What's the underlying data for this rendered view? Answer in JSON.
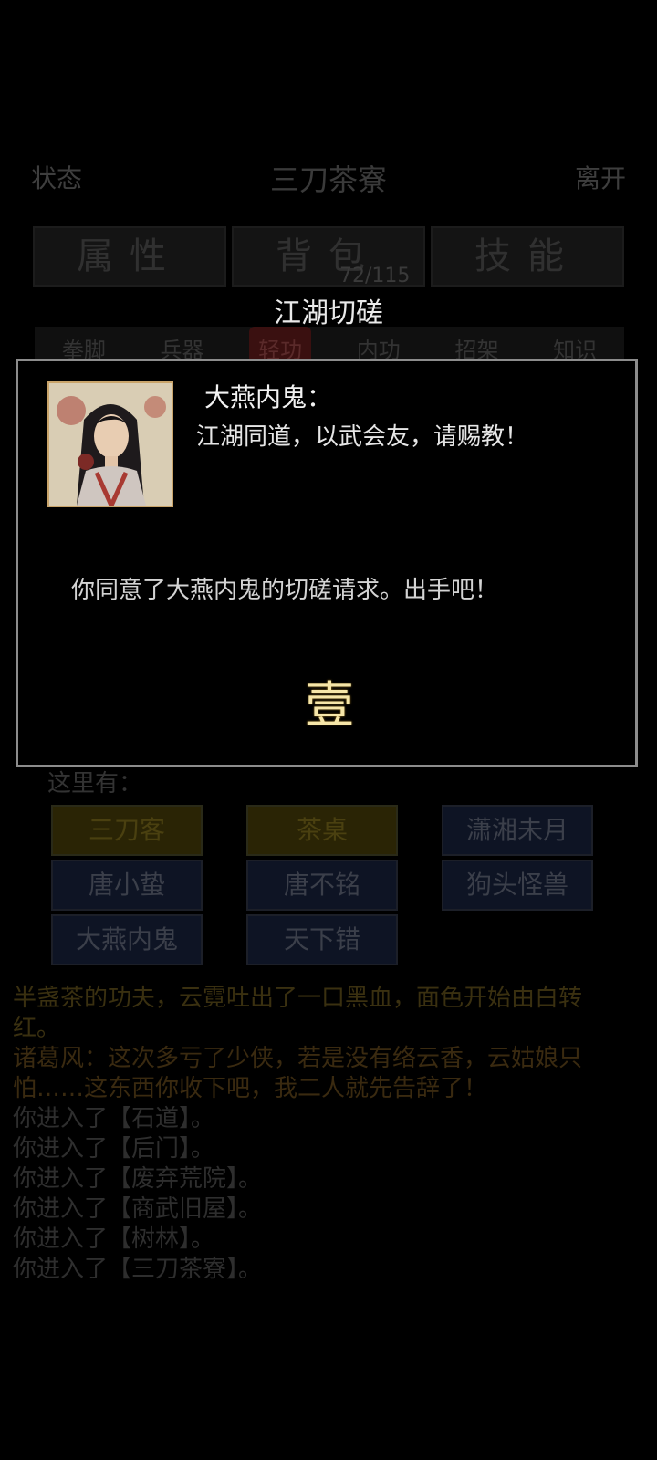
{
  "header": {
    "left": "状态",
    "title": "三刀茶寮",
    "right": "离开"
  },
  "main_tabs": [
    "属性",
    "背包",
    "技能"
  ],
  "bag_count": "72/115",
  "sub_tabs": [
    "拳脚",
    "兵器",
    "轻功",
    "内功",
    "招架",
    "知识"
  ],
  "npc_section_label": "这里有：",
  "npcs": [
    "三刀客",
    "茶桌",
    "潇湘未月",
    "唐小蛰",
    "唐不铭",
    "狗头怪兽",
    "大燕内鬼",
    "天下错"
  ],
  "log": [
    "半盏茶的功夫，云霓吐出了一口黑血，面色开始由白转",
    "红。",
    "诸葛风：这次多亏了少侠，若是没有络云香，云姑娘只",
    "怕……这东西你收下吧，我二人就先告辞了！",
    "你进入了【石道】。",
    "你进入了【后门】。",
    "你进入了【废弃荒院】。",
    "你进入了【商武旧屋】。",
    "你进入了【树林】。",
    "你进入了【三刀茶寮】。"
  ],
  "dialog": {
    "title": "江湖切磋",
    "speaker": "大燕内鬼：",
    "speech": "江湖同道，以武会友，请赐教！",
    "message": "你同意了大燕内鬼的切磋请求。出手吧！",
    "countdown": "壹"
  }
}
